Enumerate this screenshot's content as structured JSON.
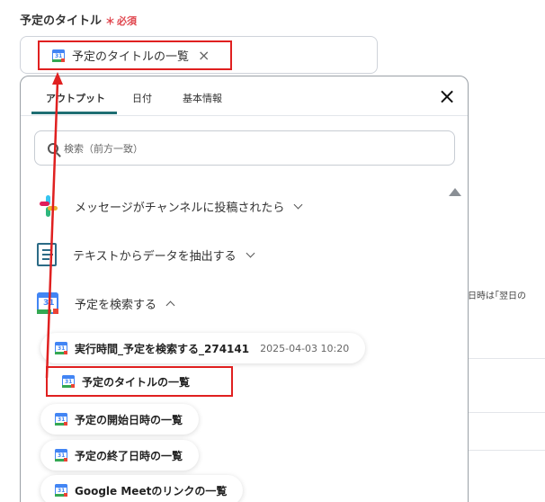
{
  "field": {
    "label": "予定のタイトル",
    "required_mark": "＊",
    "required_text": "必須",
    "chip_text": "予定のタイトルの一覧",
    "chip_remove": "×"
  },
  "panel": {
    "tabs": [
      "アウトプット",
      "日付",
      "基本情報"
    ],
    "active_tab": "アウトプット",
    "close_label": "×",
    "search_placeholder": "検索（前方一致）",
    "sections": [
      {
        "label": "メッセージがチャンネルに投稿されたら",
        "icon": "slack-icon",
        "expanded": false
      },
      {
        "label": "テキストからデータを抽出する",
        "icon": "ocr-document-icon",
        "expanded": false
      },
      {
        "label": "予定を検索する",
        "icon": "google-calendar-icon",
        "expanded": true
      }
    ],
    "items": [
      {
        "label": "実行時間_予定を検索する_274141",
        "value": "2025-04-03 10:20"
      },
      {
        "label": "予定のタイトルの一覧",
        "value": ""
      },
      {
        "label": "予定の開始日時の一覧",
        "value": ""
      },
      {
        "label": "予定の終了日時の一覧",
        "value": ""
      },
      {
        "label": "Google Meetのリンクの一覧",
        "value": ""
      }
    ]
  },
  "background": {
    "partial_text": "了日時は｢翌日の"
  },
  "colors": {
    "highlight": "#e02020",
    "required": "#e0464e",
    "tab_underline": "#1f6e73",
    "calendar_blue": "#4285f4"
  }
}
